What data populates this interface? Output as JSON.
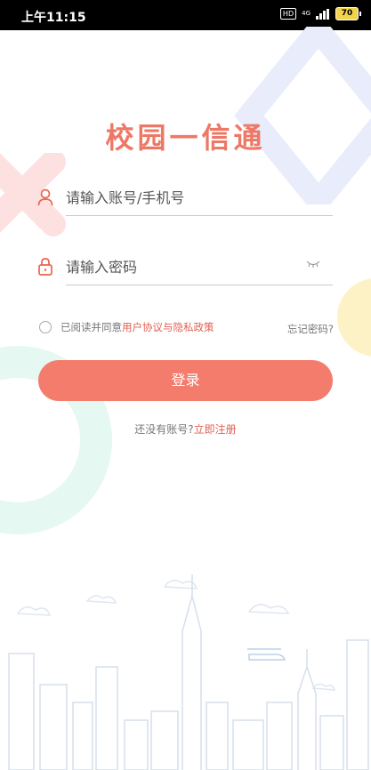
{
  "status_bar": {
    "time": "上午11:15",
    "hd": "HD",
    "network": "4G",
    "battery": "70"
  },
  "app": {
    "title": "校园一信通"
  },
  "login": {
    "account_placeholder": "请输入账号/手机号",
    "password_placeholder": "请输入密码",
    "agree_prefix": "已阅读并同意",
    "agree_link": "用户协议与隐私政策",
    "forgot": "忘记密码?",
    "submit": "登录",
    "register_prefix": "还没有账号?",
    "register_link": "立即注册"
  },
  "colors": {
    "accent": "#f47c6d",
    "title": "#ee7866",
    "link": "#e06050"
  },
  "icons": {
    "account": "user-icon",
    "password": "lock-icon",
    "eye": "eye-closed-icon"
  }
}
